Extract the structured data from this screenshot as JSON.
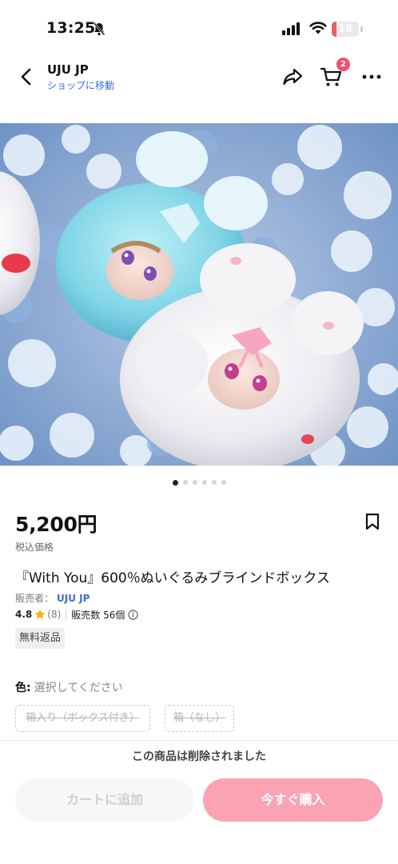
{
  "status_bar": {
    "time": "13:25",
    "battery": "18",
    "battery_level": 0.18
  },
  "header": {
    "shop_name": "UJU JP",
    "shop_link": "ショップに移動",
    "cart_count": "2"
  },
  "carousel": {
    "total": 6,
    "active_index": 0
  },
  "product": {
    "price": "5,200円",
    "tax_label": "税込価格",
    "title": "『With You』600％ぬいぐるみブラインドボックス",
    "seller_label": "販売者：",
    "seller_name": "UJU JP",
    "rating": "4.8",
    "review_count": "(8)",
    "sales": "販売数 56個",
    "free_return": "無料返品"
  },
  "options": {
    "color_label": "色:",
    "color_placeholder": "選択してください",
    "items": [
      "箱入り（ボックス付き）",
      "箱（なし）"
    ]
  },
  "notice": "この商品は削除されました",
  "actions": {
    "add_to_cart": "カートに追加",
    "buy_now": "今すぐ購入"
  },
  "colors": {
    "accent_blue": "#3b6fd4",
    "badge_red": "#f0506e",
    "buy_pink": "#f9a3b3",
    "star_yellow": "#f5b400"
  }
}
